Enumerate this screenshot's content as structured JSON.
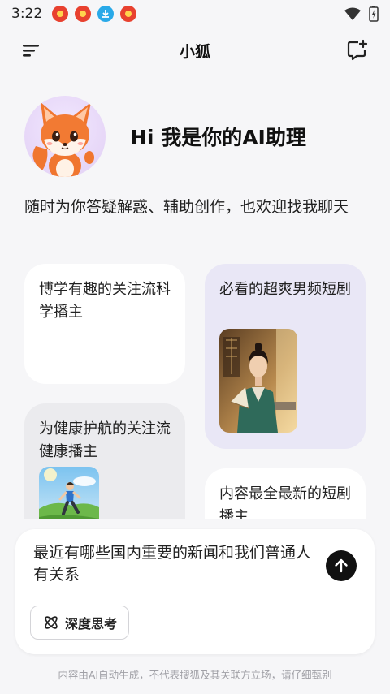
{
  "status_bar": {
    "time": "3:22",
    "notifications": [
      "app-notification-icon",
      "app-notification-icon",
      "download-icon",
      "app-notification-icon"
    ],
    "right_icons": [
      "wifi-icon",
      "battery-charging-icon"
    ]
  },
  "header": {
    "title": "小狐",
    "left_icon": "menu-icon",
    "right_icon": "new-chat-icon"
  },
  "hero": {
    "greeting": "Hi 我是你的AI助理",
    "avatar": "fox-avatar"
  },
  "intro": "随时为你答疑解惑、辅助创作，也欢迎找我聊天",
  "cards": [
    {
      "label": "博学有趣的关注流科学播主"
    },
    {
      "label": "必看的超爽男频短剧",
      "image": "drama-actor-thumbnail"
    },
    {
      "label": "为健康护航的关注流健康播主",
      "image": "runner-thumbnail"
    },
    {
      "label": "内容最全最新的短剧播主"
    }
  ],
  "input": {
    "text": "最近有哪些国内重要的新闻和我们普通人有关系",
    "send_icon": "arrow-up-icon",
    "deep_think_label": "深度思考",
    "deep_think_icon": "atom-icon"
  },
  "disclaimer": "内容由AI自动生成，不代表搜狐及其关联方立场，请仔细甄别",
  "colors": {
    "background": "#f6f6f8",
    "card_purple": "#e9e7f6",
    "card_gray": "#ebebee",
    "send_button": "#111111",
    "notif_red": "#e8412f",
    "notif_blue": "#29a9e8"
  }
}
